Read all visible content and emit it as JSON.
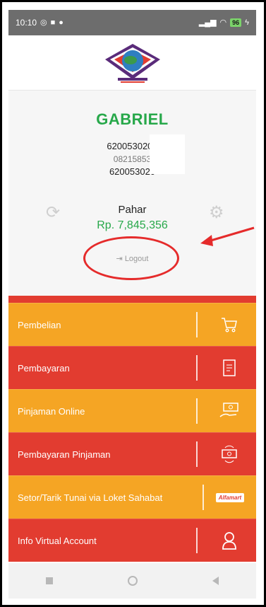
{
  "status_bar": {
    "time": "10:10",
    "battery": "96"
  },
  "profile": {
    "name": "GABRIEL",
    "account_line1": "6200530200",
    "phone": "08215853",
    "account_line2": "620053020",
    "balance_name": "Pahar",
    "balance_amount": "Rp. 7,845,356",
    "logout_label": "Logout"
  },
  "menu": [
    {
      "label": "Pembelian",
      "color": "#f5a524",
      "icon": "cart-icon"
    },
    {
      "label": "Pembayaran",
      "color": "#e23c30",
      "icon": "receipt-icon"
    },
    {
      "label": "Pinjaman Online",
      "color": "#f5a524",
      "icon": "money-hand-icon"
    },
    {
      "label": "Pembayaran Pinjaman",
      "color": "#e23c30",
      "icon": "cash-cycle-icon"
    },
    {
      "label": "Setor/Tarik Tunai via Loket Sahabat",
      "color": "#f5a524",
      "icon": "alfamart-logo"
    },
    {
      "label": "Info Virtual Account",
      "color": "#e23c30",
      "icon": "user-icon"
    }
  ],
  "alfamart_text": "Alfamart",
  "colors": {
    "accent_green": "#27a84a",
    "orange": "#f5a524",
    "red": "#e23c30",
    "annotation_red": "#e52b2b"
  }
}
